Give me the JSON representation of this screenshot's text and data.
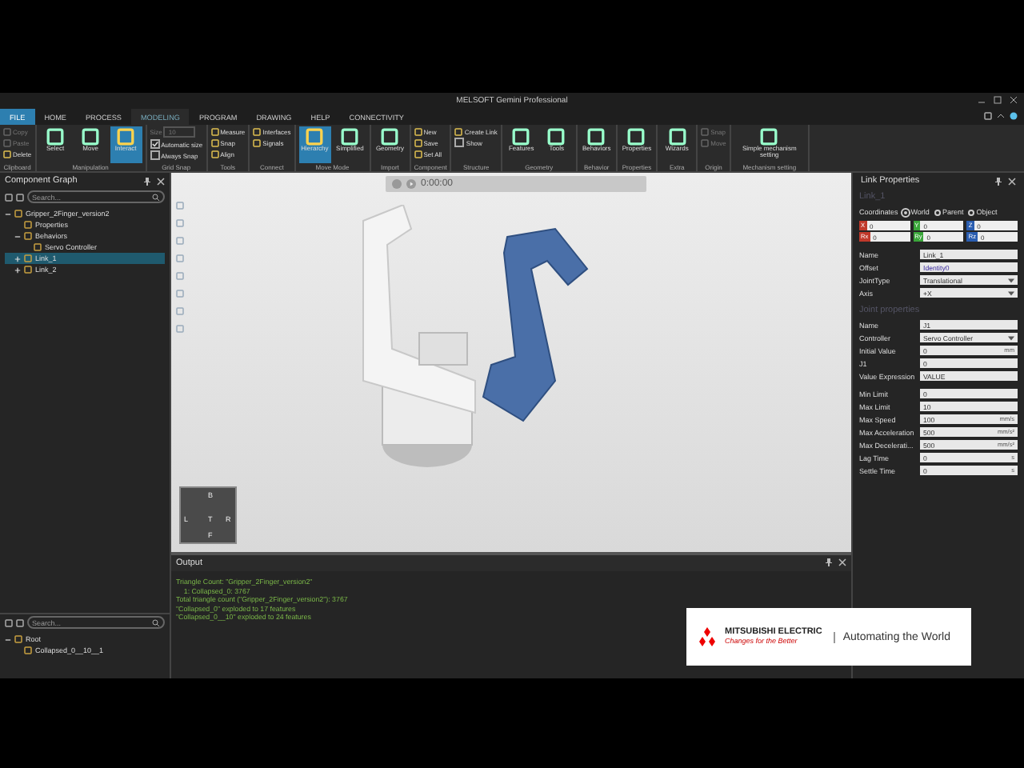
{
  "window": {
    "title": "MELSOFT Gemini Professional"
  },
  "tabs": [
    {
      "label": "FILE",
      "kind": "file",
      "selected": false
    },
    {
      "label": "HOME",
      "kind": "tab",
      "selected": false
    },
    {
      "label": "PROCESS",
      "kind": "tab",
      "selected": false
    },
    {
      "label": "MODELING",
      "kind": "tab",
      "selected": true
    },
    {
      "label": "PROGRAM",
      "kind": "tab",
      "selected": false
    },
    {
      "label": "DRAWING",
      "kind": "tab",
      "selected": false
    },
    {
      "label": "HELP",
      "kind": "tab",
      "selected": false
    },
    {
      "label": "CONNECTIVITY",
      "kind": "tab",
      "selected": false
    }
  ],
  "ribbon": [
    {
      "label": "Clipboard",
      "items": [
        {
          "kind": "small",
          "label": "Copy",
          "disabled": true
        },
        {
          "kind": "small",
          "label": "Paste",
          "disabled": true
        },
        {
          "kind": "small",
          "label": "Delete",
          "disabled": false
        }
      ]
    },
    {
      "label": "Manipulation",
      "items": [
        {
          "kind": "large",
          "label": "Select",
          "selected": false
        },
        {
          "kind": "large",
          "label": "Move",
          "selected": false
        },
        {
          "kind": "large",
          "label": "Interact",
          "selected": true
        }
      ]
    },
    {
      "label": "Grid Snap",
      "items": [
        {
          "kind": "field",
          "label": "Size",
          "value": "10",
          "disabled": true
        },
        {
          "kind": "check",
          "label": "Automatic size",
          "checked": true
        },
        {
          "kind": "check",
          "label": "Always Snap",
          "checked": false
        }
      ]
    },
    {
      "label": "Tools",
      "items": [
        {
          "kind": "small",
          "label": "Measure",
          "disabled": false
        },
        {
          "kind": "small",
          "label": "Snap",
          "disabled": false
        },
        {
          "kind": "small",
          "label": "Align",
          "disabled": false
        }
      ]
    },
    {
      "label": "Connect",
      "items": [
        {
          "kind": "small",
          "label": "Interfaces",
          "disabled": false
        },
        {
          "kind": "small",
          "label": "Signals",
          "disabled": false
        }
      ]
    },
    {
      "label": "Move Mode",
      "items": [
        {
          "kind": "large",
          "label": "Hierarchy",
          "selected": true
        },
        {
          "kind": "large",
          "label": "Simplified",
          "selected": false
        }
      ]
    },
    {
      "label": "Import",
      "items": [
        {
          "kind": "large",
          "label": "Geometry"
        }
      ]
    },
    {
      "label": "Component",
      "items": [
        {
          "kind": "small",
          "label": "New",
          "disabled": false
        },
        {
          "kind": "small",
          "label": "Save",
          "disabled": false
        },
        {
          "kind": "small",
          "label": "Set All",
          "disabled": false
        }
      ]
    },
    {
      "label": "Structure",
      "items": [
        {
          "kind": "small",
          "label": "Create Link",
          "disabled": false
        },
        {
          "kind": "check",
          "label": "Show",
          "checked": false
        }
      ]
    },
    {
      "label": "Geometry",
      "items": [
        {
          "kind": "large",
          "label": "Features"
        },
        {
          "kind": "large",
          "label": "Tools"
        }
      ]
    },
    {
      "label": "Behavior",
      "items": [
        {
          "kind": "large",
          "label": "Behaviors"
        }
      ]
    },
    {
      "label": "Properties",
      "items": [
        {
          "kind": "large",
          "label": "Properties"
        }
      ]
    },
    {
      "label": "Extra",
      "items": [
        {
          "kind": "large",
          "label": "Wizards"
        }
      ]
    },
    {
      "label": "Origin",
      "items": [
        {
          "kind": "small",
          "label": "Snap",
          "disabled": true
        },
        {
          "kind": "small",
          "label": "Move",
          "disabled": true
        }
      ]
    },
    {
      "label": "Mechanism setting",
      "items": [
        {
          "kind": "large",
          "label": "Simple mechanism setting"
        }
      ]
    }
  ],
  "component_graph": {
    "title": "Component Graph",
    "search": {
      "placeholder": "Search..."
    },
    "tree": [
      {
        "label": "Gripper_2Finger_version2",
        "selected": false,
        "expanded": true,
        "children": [
          {
            "label": "Properties",
            "selected": false
          },
          {
            "label": "Behaviors",
            "selected": false,
            "expanded": true,
            "children": [
              {
                "label": "Servo Controller",
                "selected": false
              }
            ]
          },
          {
            "label": "Link_1",
            "selected": true,
            "expanded": false
          },
          {
            "label": "Link_2",
            "selected": false,
            "expanded": false
          }
        ]
      }
    ],
    "bottom_search": {
      "placeholder": "Search..."
    },
    "bottom_tree": [
      {
        "label": "Root",
        "selected": false,
        "expanded": true,
        "children": [
          {
            "label": "Collapsed_0__10__1",
            "selected": false
          }
        ]
      }
    ]
  },
  "viewport": {
    "time": "0:00:00",
    "nav_cube": [
      "B",
      "L",
      "T",
      "R",
      "F"
    ]
  },
  "output": {
    "title": "Output",
    "lines": [
      "Triangle Count: \"Gripper_2Finger_version2\"",
      "    1: Collapsed_0: 3767",
      "Total triangle count (\"Gripper_2Finger_version2\"): 3767",
      "\"Collapsed_0\" exploded to 17 features",
      "\"Collapsed_0__10\" exploded to 24 features"
    ]
  },
  "logo": {
    "brand": "MITSUBISHI ELECTRIC",
    "slogan": "Changes for the Better",
    "tagline": "Automating the World"
  },
  "link_properties": {
    "title": "Link Properties",
    "subtitle": "Link_1",
    "coordinates_label": "Coordinates",
    "coordinates": [
      {
        "label": "World",
        "selected": true
      },
      {
        "label": "Parent",
        "selected": false
      },
      {
        "label": "Object",
        "selected": false
      }
    ],
    "axes": [
      {
        "label": "X",
        "value": "0",
        "color": "#c0392b"
      },
      {
        "label": "Y",
        "value": "0",
        "color": "#3aa63a"
      },
      {
        "label": "Z",
        "value": "0",
        "color": "#2a5db0"
      },
      {
        "label": "Rx",
        "value": "0",
        "color": "#c0392b"
      },
      {
        "label": "Ry",
        "value": "0",
        "color": "#3aa63a"
      },
      {
        "label": "Rz",
        "value": "0",
        "color": "#2a5db0"
      }
    ],
    "fields": [
      {
        "kind": "text",
        "label": "Name",
        "value": "Link_1"
      },
      {
        "kind": "link",
        "label": "Offset",
        "value": "Identity0"
      },
      {
        "kind": "dropdown",
        "label": "JointType",
        "value": "Translational"
      },
      {
        "kind": "dropdown",
        "label": "Axis",
        "value": "+X"
      }
    ],
    "joint_title": "Joint properties",
    "joint_fields": [
      {
        "kind": "text",
        "label": "Name",
        "value": "J1"
      },
      {
        "kind": "dropdown",
        "label": "Controller",
        "value": "Servo Controller"
      },
      {
        "kind": "text",
        "label": "Initial Value",
        "value": "0",
        "unit": "mm"
      },
      {
        "kind": "text",
        "label": "J1",
        "value": "0"
      },
      {
        "kind": "text",
        "label": "Value Expression",
        "value": "VALUE"
      },
      {
        "kind": "gap",
        "label": "Min Limit",
        "value": "0"
      },
      {
        "kind": "text",
        "label": "Max Limit",
        "value": "10"
      },
      {
        "kind": "text",
        "label": "Max Speed",
        "value": "100",
        "unit": "mm/s"
      },
      {
        "kind": "text",
        "label": "Max Acceleration",
        "value": "500",
        "unit": "mm/s²"
      },
      {
        "kind": "text",
        "label": "Max Decelerati...",
        "value": "500",
        "unit": "mm/s²"
      },
      {
        "kind": "spin",
        "label": "Lag Time",
        "value": "0",
        "unit": "s"
      },
      {
        "kind": "spin",
        "label": "Settle Time",
        "value": "0",
        "unit": "s"
      }
    ]
  }
}
